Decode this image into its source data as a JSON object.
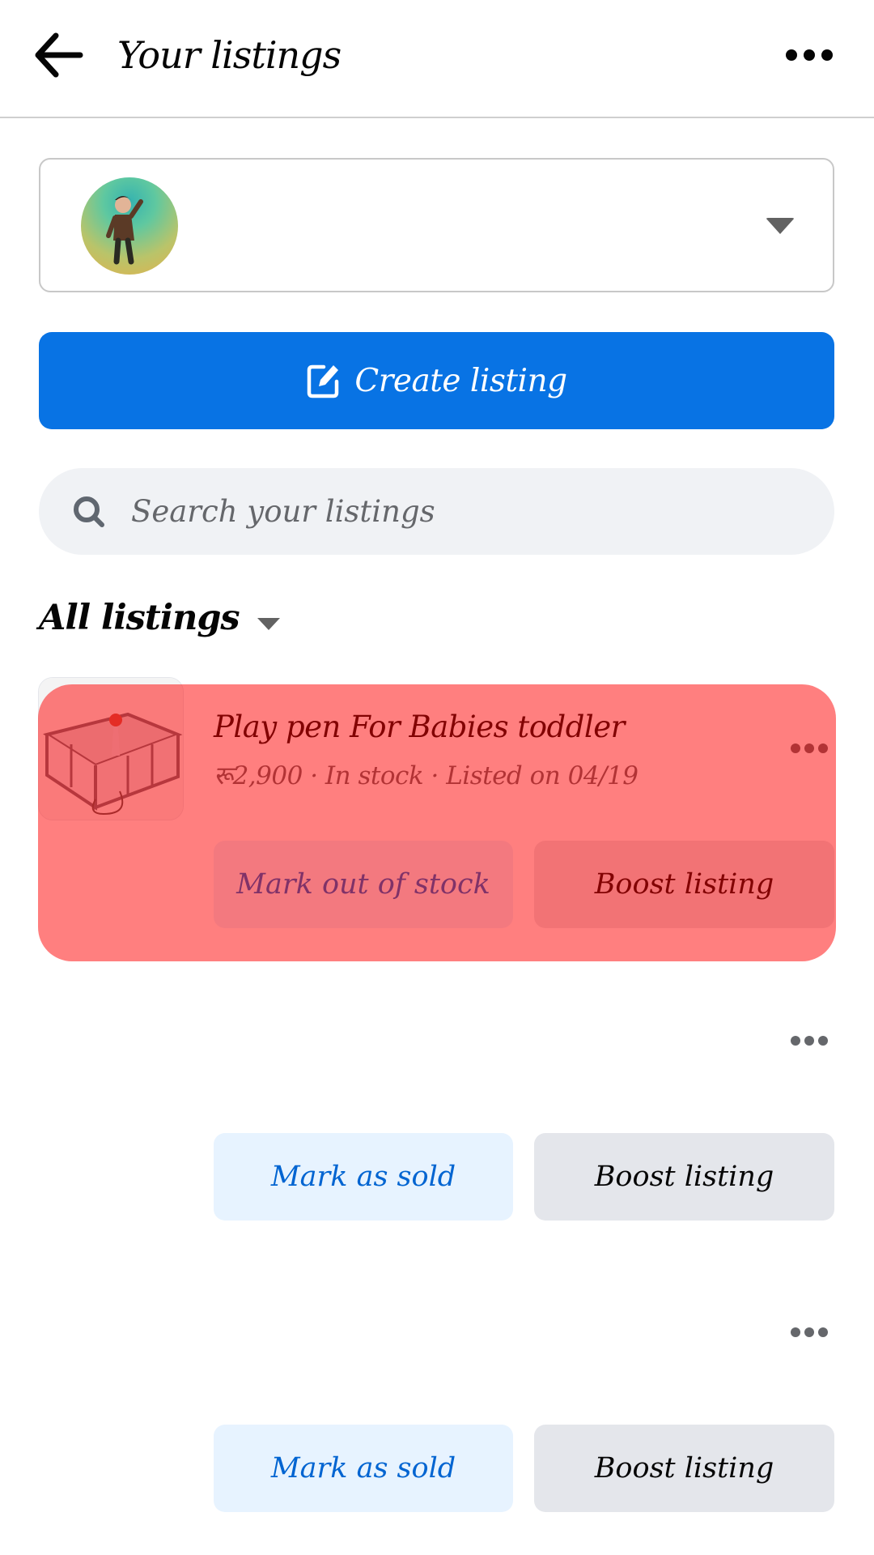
{
  "header": {
    "back_icon": "arrow-left-icon",
    "title": "Your listings",
    "more_icon": "more-horizontal-icon"
  },
  "profile_selector": {
    "avatar": "user-avatar",
    "caret_icon": "caret-down-icon"
  },
  "create_button": {
    "icon": "edit-square-icon",
    "label": "Create listing",
    "color": "#0873E4"
  },
  "search": {
    "icon": "search-icon",
    "placeholder": "Search your listings",
    "value": ""
  },
  "filter": {
    "label": "All listings",
    "caret_icon": "caret-down-icon"
  },
  "listings": [
    {
      "title": "Play pen For Babies toddler",
      "meta": "रू2,900 · In stock · Listed on 04/19",
      "thumbnail": "playpen-image",
      "primary_action": "Mark out of stock",
      "secondary_action": "Boost listing",
      "highlighted": true
    },
    {
      "title": "",
      "meta": "",
      "thumbnail": "",
      "primary_action": "Mark as sold",
      "secondary_action": "Boost listing",
      "highlighted": false
    },
    {
      "title": "",
      "meta": "",
      "thumbnail": "",
      "primary_action": "Mark as sold",
      "secondary_action": "Boost listing",
      "highlighted": false
    }
  ],
  "highlight_color": "#FF7F7F"
}
